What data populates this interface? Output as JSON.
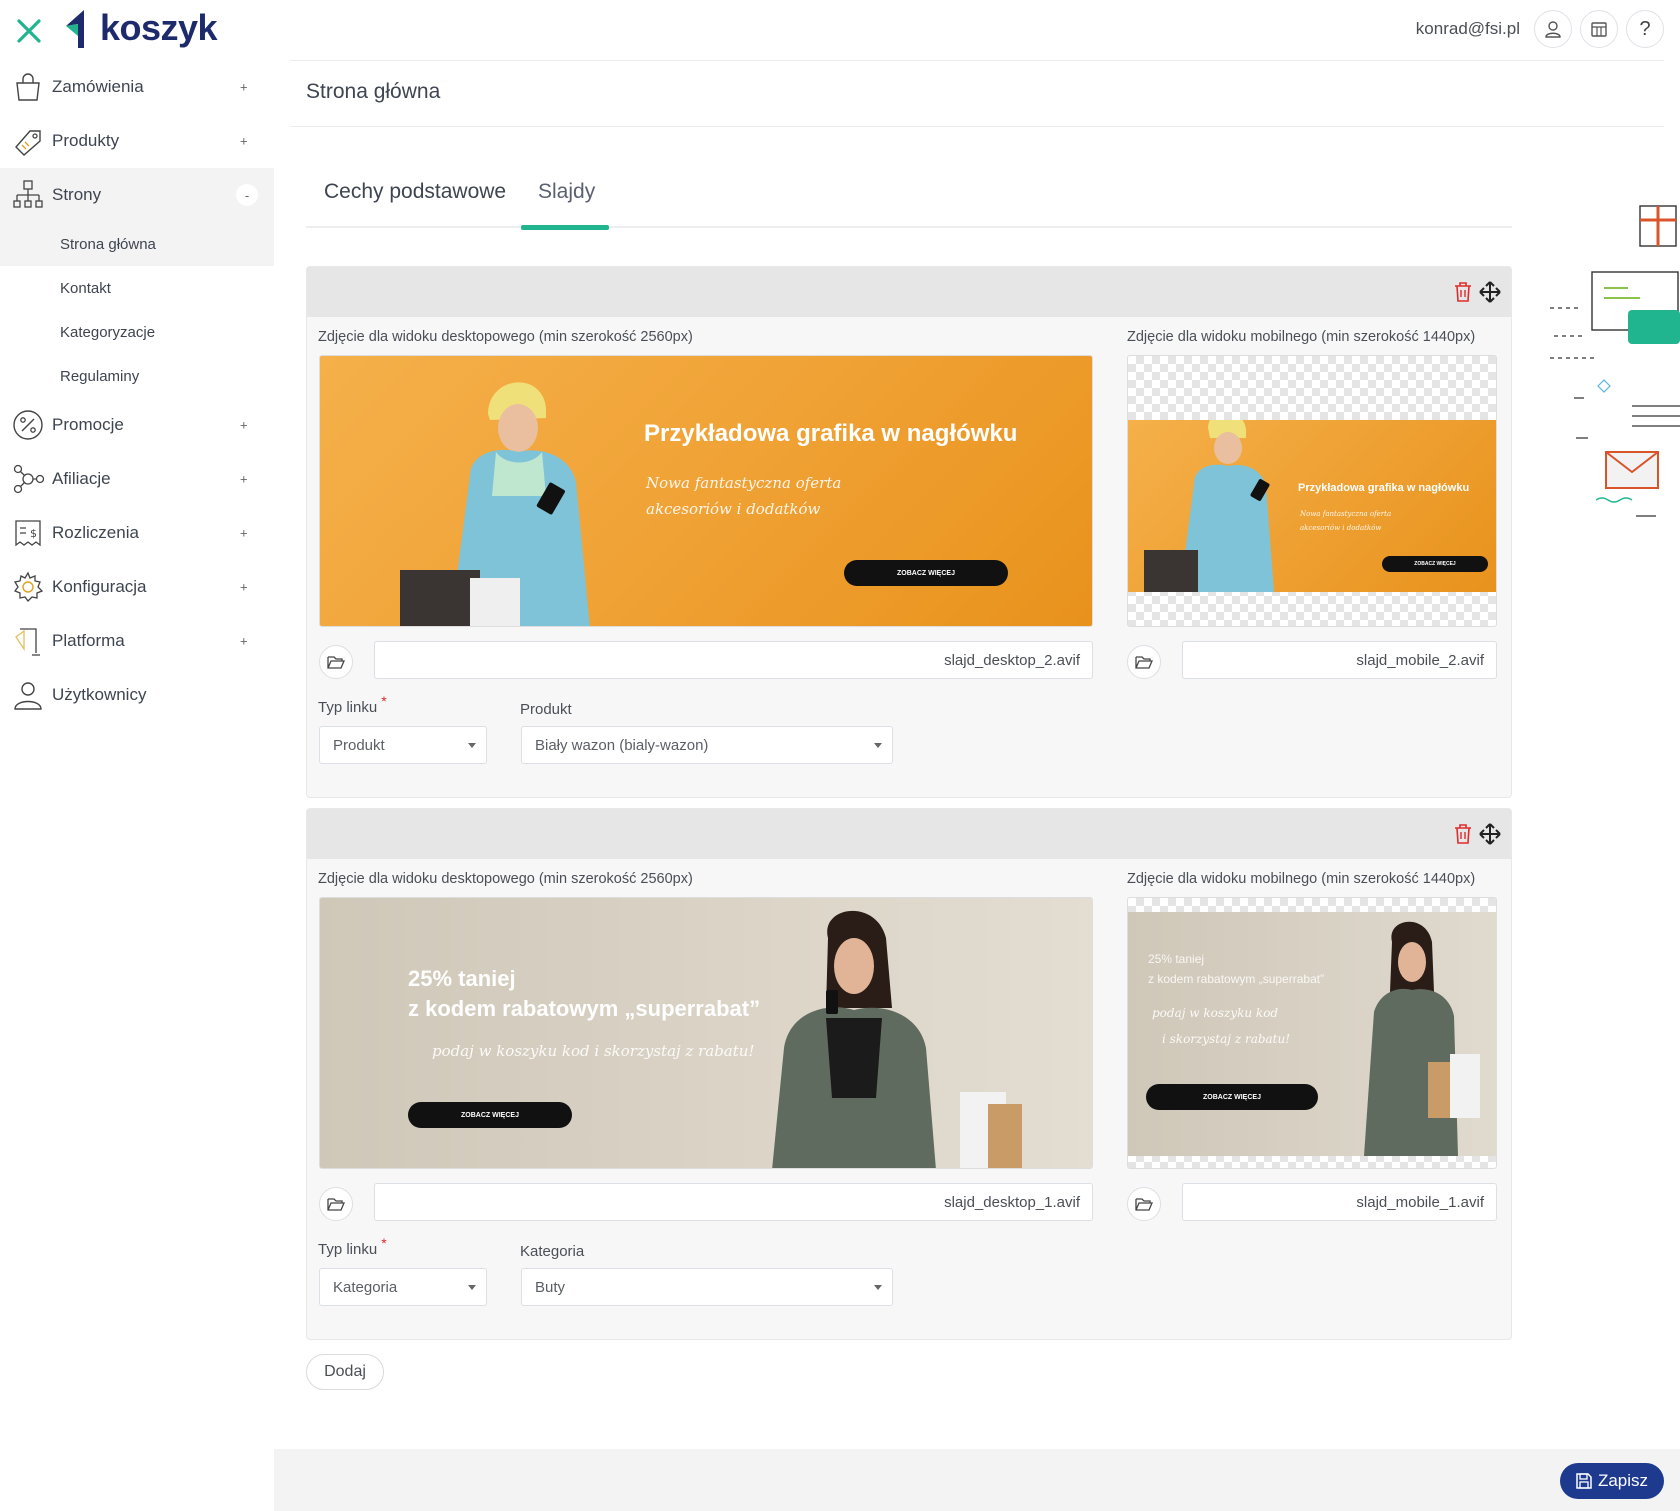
{
  "app": {
    "logo_text": "koszyk",
    "user_email": "konrad@fsi.pl"
  },
  "sidebar": {
    "items": [
      {
        "label": "Zamówienia",
        "toggle": "+"
      },
      {
        "label": "Produkty",
        "toggle": "+"
      },
      {
        "label": "Strony",
        "toggle": "-"
      },
      {
        "label": "Promocje",
        "toggle": "+"
      },
      {
        "label": "Afiliacje",
        "toggle": "+"
      },
      {
        "label": "Rozliczenia",
        "toggle": "+"
      },
      {
        "label": "Konfiguracja",
        "toggle": "+"
      },
      {
        "label": "Platforma",
        "toggle": "+"
      },
      {
        "label": "Użytkownicy",
        "toggle": ""
      }
    ],
    "subitems": [
      "Strona główna",
      "Kontakt",
      "Kategoryzacje",
      "Regulaminy"
    ]
  },
  "page": {
    "title": "Strona główna"
  },
  "tabs": [
    "Cechy podstawowe",
    "Slajdy"
  ],
  "slides": [
    {
      "desktop_label": "Zdjęcie dla widoku desktopowego (min szerokość 2560px)",
      "mobile_label": "Zdjęcie dla widoku mobilnego (min szerokość 1440px)",
      "desktop_file": "slajd_desktop_2.avif",
      "mobile_file": "slajd_mobile_2.avif",
      "link_type_label": "Typ linku",
      "link_type_value": "Produkt",
      "target_label": "Produkt",
      "target_value": "Biały wazon (bialy-wazon)",
      "banner": {
        "headline": "Przykładowa grafika w nagłówku",
        "script_line1": "Nowa fantastyczna oferta",
        "script_line2": "akcesoriów i dodatków",
        "cta": "ZOBACZ WIĘCEJ"
      }
    },
    {
      "desktop_label": "Zdjęcie dla widoku desktopowego (min szerokość 2560px)",
      "mobile_label": "Zdjęcie dla widoku mobilnego (min szerokość 1440px)",
      "desktop_file": "slajd_desktop_1.avif",
      "mobile_file": "slajd_mobile_1.avif",
      "link_type_label": "Typ linku",
      "link_type_value": "Kategoria",
      "target_label": "Kategoria",
      "target_value": "Buty",
      "banner": {
        "headline_line1": "25% taniej",
        "headline_line2": "z kodem rabatowym „superrabat”",
        "script_line": "podaj w koszyku kod i skorzystaj z rabatu!",
        "script_m1": "podaj w koszyku kod",
        "script_m2": "i skorzystaj z rabatu!",
        "cta": "ZOBACZ WIĘCEJ"
      }
    }
  ],
  "actions": {
    "add": "Dodaj",
    "save": "Zapisz"
  },
  "colors": {
    "accent": "#20b58f",
    "primary": "#1d3a8f",
    "banner_orange": "#f0a62e",
    "banner_beige": "#d8d1c4",
    "danger": "#e02b2b"
  }
}
